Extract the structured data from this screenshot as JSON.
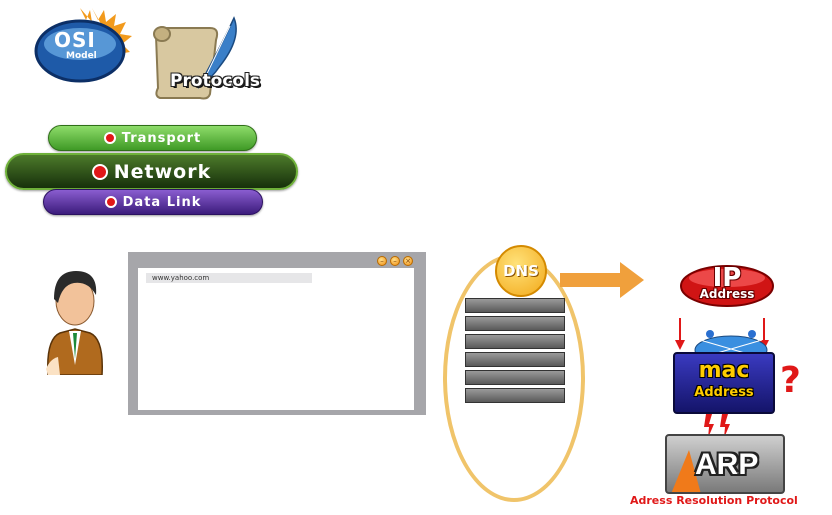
{
  "osi_logo": {
    "title": "OSI",
    "subtitle": "Model"
  },
  "protocols_logo": {
    "text": "Protocols"
  },
  "layers": [
    {
      "label": "Transport",
      "color": "#5cb83a"
    },
    {
      "label": "Network",
      "color": "#2c4a16"
    },
    {
      "label": "Data Link",
      "color": "#5b32a0"
    }
  ],
  "browser": {
    "url": "www.yahoo.com"
  },
  "dns": {
    "label": "DNS",
    "server_count": 6
  },
  "ip_address": {
    "title": "IP",
    "subtitle": "Address"
  },
  "mac_address": {
    "title": "mac",
    "subtitle": "Address",
    "question_mark": "?"
  },
  "arp": {
    "title": "ARP",
    "caption": "Adress Resolution Protocol"
  },
  "colors": {
    "arrow": "#f0a03c",
    "accent_red": "#e01818",
    "ellipse": "#f0c46a"
  }
}
